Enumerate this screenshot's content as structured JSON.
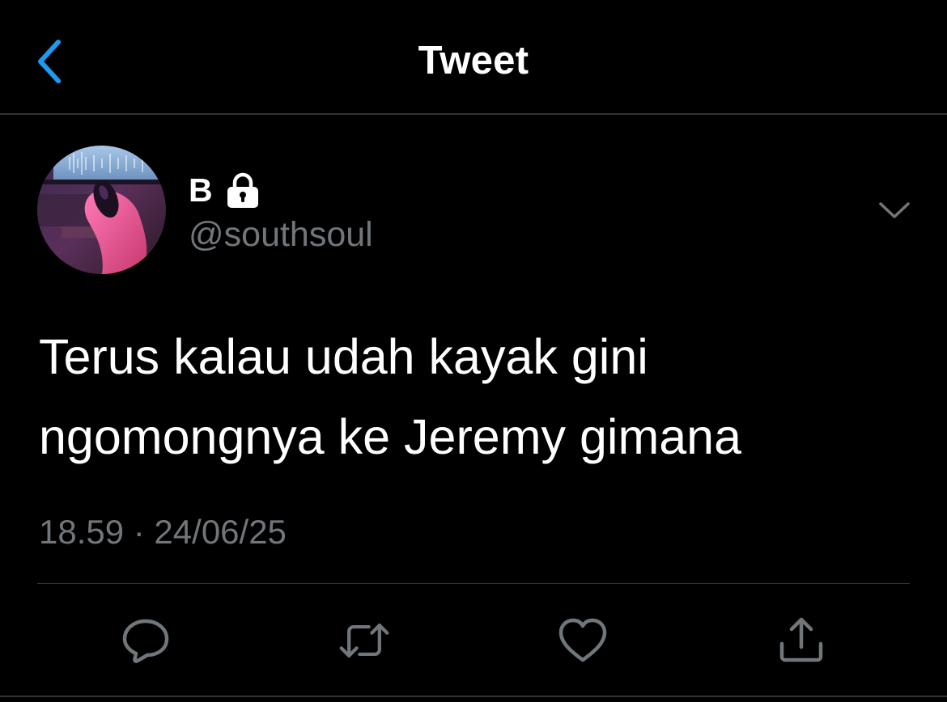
{
  "header": {
    "title": "Tweet",
    "back_icon": "chevron-left-icon"
  },
  "tweet": {
    "author": {
      "display_name": "B",
      "handle": "@southsoul",
      "protected_icon": "lock-icon"
    },
    "text": "Terus kalau udah kayak gini\nngomongnya ke Jeremy gimana",
    "timestamp": "18.59 · 24/06/25",
    "more_icon": "chevron-down-icon"
  },
  "actions": [
    {
      "name": "reply",
      "icon": "reply-icon"
    },
    {
      "name": "retweet",
      "icon": "retweet-icon"
    },
    {
      "name": "like",
      "icon": "heart-icon"
    },
    {
      "name": "share",
      "icon": "share-icon"
    }
  ],
  "colors": {
    "background": "#000000",
    "accent": "#1d9bf0",
    "text_primary": "#ffffff",
    "text_secondary": "#71767b",
    "divider": "#2f3336"
  }
}
